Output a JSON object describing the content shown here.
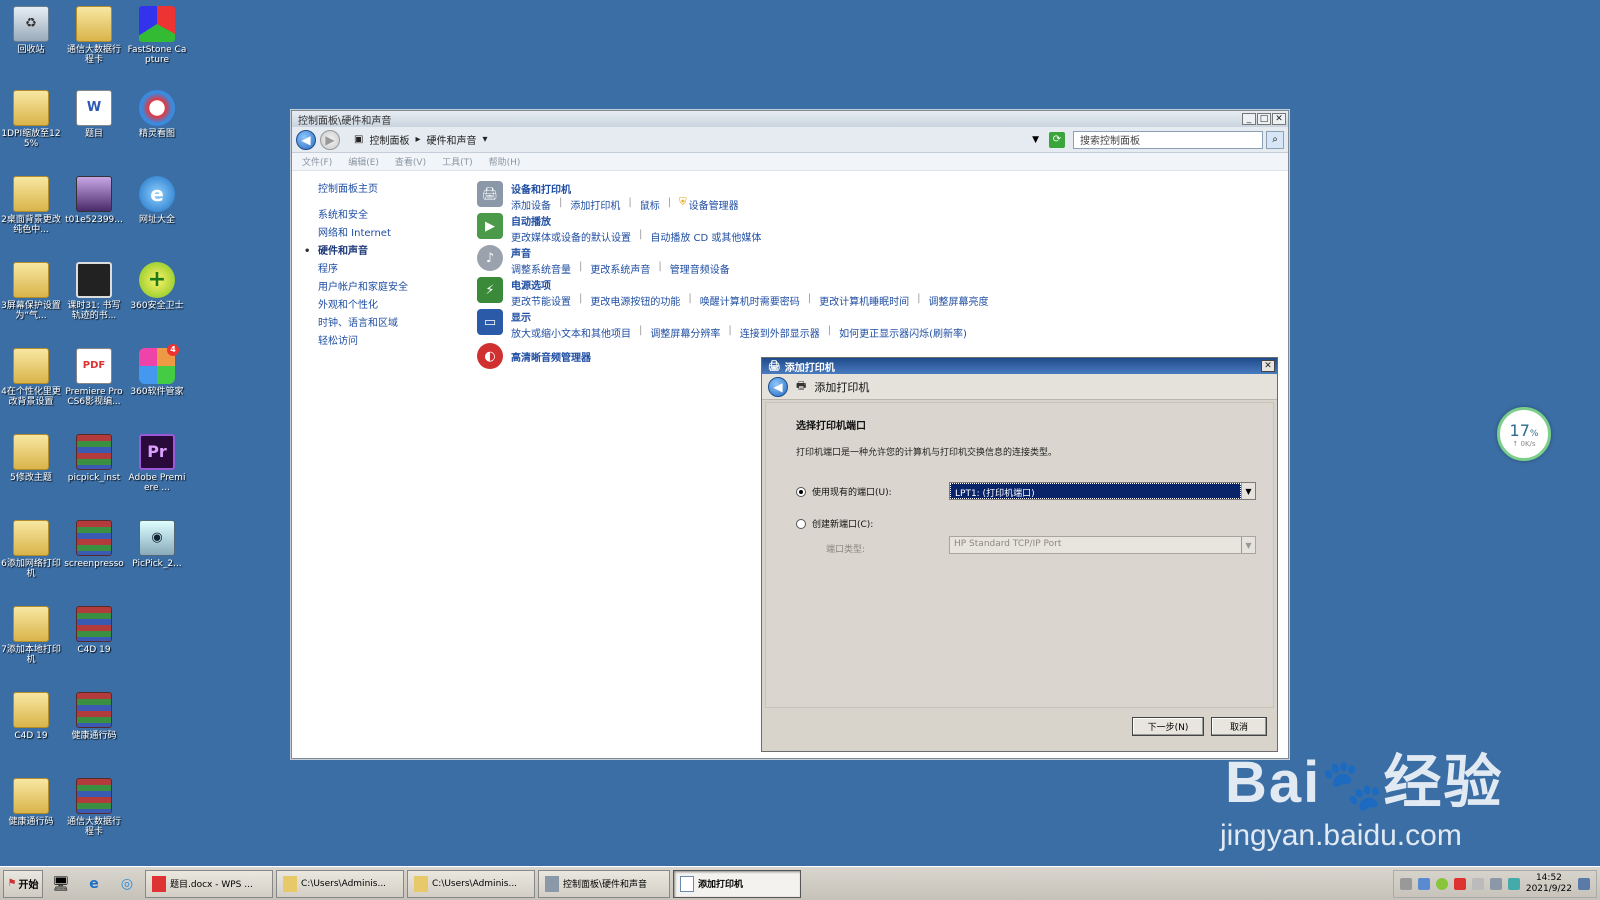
{
  "desktop": {
    "icons": [
      {
        "label": "回收站"
      },
      {
        "label": "通信大数据行程卡"
      },
      {
        "label": "FastStone Capture"
      },
      {
        "label": "1DPI缩放至125%"
      },
      {
        "label": "题目"
      },
      {
        "label": "精灵看图"
      },
      {
        "label": "2桌面背景更改纯色中..."
      },
      {
        "label": "t01e52399..."
      },
      {
        "label": "网址大全"
      },
      {
        "label": "3屏幕保护设置为“气..."
      },
      {
        "label": "课时31: 书写轨迹的书..."
      },
      {
        "label": "360安全卫士"
      },
      {
        "label": "4在个性化里更改背景设置"
      },
      {
        "label": "Premiere Pro CS6影视编..."
      },
      {
        "label": "360软件管家"
      },
      {
        "label": "5修改主题"
      },
      {
        "label": "picpick_inst"
      },
      {
        "label": "Adobe Premiere ..."
      },
      {
        "label": "6添加网络打印机"
      },
      {
        "label": "screenpresso"
      },
      {
        "label": "PicPick_2..."
      },
      {
        "label": "7添加本地打印机"
      },
      {
        "label": "C4D 19"
      },
      {
        "label": "C4D 19"
      },
      {
        "label": "健康通行码"
      },
      {
        "label": "健康通行码"
      },
      {
        "label": "通信大数据行程卡"
      }
    ],
    "badge_360mgr": "4"
  },
  "cp_window": {
    "title": "控制面板\\硬件和声音",
    "address": [
      "控制面板",
      "硬件和声音"
    ],
    "search_placeholder": "搜索控制面板",
    "menu": [
      "文件(F)",
      "编辑(E)",
      "查看(V)",
      "工具(T)",
      "帮助(H)"
    ],
    "sidebar": {
      "home": "控制面板主页",
      "items": [
        "系统和安全",
        "网络和 Internet",
        "硬件和声音",
        "程序",
        "用户帐户和家庭安全",
        "外观和个性化",
        "时钟、语言和区域",
        "轻松访问"
      ]
    },
    "categories": {
      "devices": {
        "title": "设备和打印机",
        "links": [
          "添加设备",
          "添加打印机",
          "鼠标",
          "设备管理器"
        ]
      },
      "autoplay": {
        "title": "自动播放",
        "links": [
          "更改媒体或设备的默认设置",
          "自动播放 CD 或其他媒体"
        ]
      },
      "sound": {
        "title": "声音",
        "links": [
          "调整系统音量",
          "更改系统声音",
          "管理音频设备"
        ]
      },
      "power": {
        "title": "电源选项",
        "links": [
          "更改节能设置",
          "更改电源按钮的功能",
          "唤醒计算机时需要密码",
          "更改计算机睡眠时间",
          "调整屏幕亮度"
        ]
      },
      "display": {
        "title": "显示",
        "links": [
          "放大或缩小文本和其他项目",
          "调整屏幕分辨率",
          "连接到外部显示器",
          "如何更正显示器闪烁(刷新率)"
        ]
      },
      "hdaudio": {
        "title": "高清晰音频管理器"
      }
    }
  },
  "dialog": {
    "title": "添加打印机",
    "header": "添加打印机",
    "heading": "选择打印机端口",
    "description": "打印机端口是一种允许您的计算机与打印机交换信息的连接类型。",
    "option_existing": "使用现有的端口(U):",
    "existing_value": "LPT1: (打印机端口)",
    "option_new": "创建新端口(C):",
    "port_type_label": "端口类型:",
    "port_type_value": "HP Standard TCP/IP Port",
    "next_button": "下一步(N)",
    "cancel_button": "取消"
  },
  "net_widget": {
    "percent": "17",
    "unit": "%",
    "speed": "↑ 0K/s"
  },
  "watermark": {
    "brand": "Bai",
    "brand_cn": "经验",
    "url": "jingyan.baidu.com"
  },
  "taskbar": {
    "start": "开始",
    "items": [
      "题目.docx - WPS ...",
      "C:\\Users\\Adminis...",
      "C:\\Users\\Adminis...",
      "控制面板\\硬件和声音",
      "添加打印机"
    ],
    "time": "14:52",
    "date": "2021/9/22"
  }
}
